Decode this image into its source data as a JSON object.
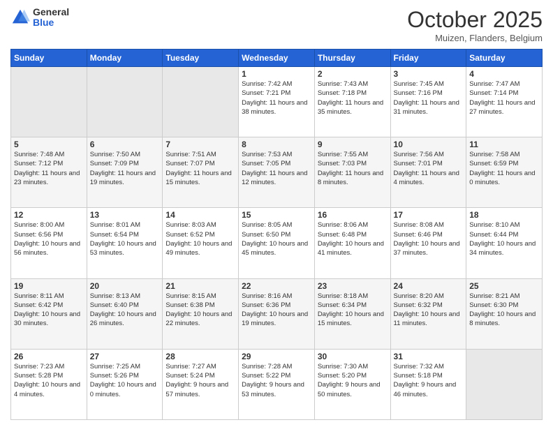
{
  "header": {
    "logo_general": "General",
    "logo_blue": "Blue",
    "month_title": "October 2025",
    "location": "Muizen, Flanders, Belgium"
  },
  "weekdays": [
    "Sunday",
    "Monday",
    "Tuesday",
    "Wednesday",
    "Thursday",
    "Friday",
    "Saturday"
  ],
  "weeks": [
    [
      {
        "day": "",
        "sunrise": "",
        "sunset": "",
        "daylight": "",
        "empty": true
      },
      {
        "day": "",
        "sunrise": "",
        "sunset": "",
        "daylight": "",
        "empty": true
      },
      {
        "day": "",
        "sunrise": "",
        "sunset": "",
        "daylight": "",
        "empty": true
      },
      {
        "day": "1",
        "sunrise": "Sunrise: 7:42 AM",
        "sunset": "Sunset: 7:21 PM",
        "daylight": "Daylight: 11 hours and 38 minutes."
      },
      {
        "day": "2",
        "sunrise": "Sunrise: 7:43 AM",
        "sunset": "Sunset: 7:18 PM",
        "daylight": "Daylight: 11 hours and 35 minutes."
      },
      {
        "day": "3",
        "sunrise": "Sunrise: 7:45 AM",
        "sunset": "Sunset: 7:16 PM",
        "daylight": "Daylight: 11 hours and 31 minutes."
      },
      {
        "day": "4",
        "sunrise": "Sunrise: 7:47 AM",
        "sunset": "Sunset: 7:14 PM",
        "daylight": "Daylight: 11 hours and 27 minutes."
      }
    ],
    [
      {
        "day": "5",
        "sunrise": "Sunrise: 7:48 AM",
        "sunset": "Sunset: 7:12 PM",
        "daylight": "Daylight: 11 hours and 23 minutes."
      },
      {
        "day": "6",
        "sunrise": "Sunrise: 7:50 AM",
        "sunset": "Sunset: 7:09 PM",
        "daylight": "Daylight: 11 hours and 19 minutes."
      },
      {
        "day": "7",
        "sunrise": "Sunrise: 7:51 AM",
        "sunset": "Sunset: 7:07 PM",
        "daylight": "Daylight: 11 hours and 15 minutes."
      },
      {
        "day": "8",
        "sunrise": "Sunrise: 7:53 AM",
        "sunset": "Sunset: 7:05 PM",
        "daylight": "Daylight: 11 hours and 12 minutes."
      },
      {
        "day": "9",
        "sunrise": "Sunrise: 7:55 AM",
        "sunset": "Sunset: 7:03 PM",
        "daylight": "Daylight: 11 hours and 8 minutes."
      },
      {
        "day": "10",
        "sunrise": "Sunrise: 7:56 AM",
        "sunset": "Sunset: 7:01 PM",
        "daylight": "Daylight: 11 hours and 4 minutes."
      },
      {
        "day": "11",
        "sunrise": "Sunrise: 7:58 AM",
        "sunset": "Sunset: 6:59 PM",
        "daylight": "Daylight: 11 hours and 0 minutes."
      }
    ],
    [
      {
        "day": "12",
        "sunrise": "Sunrise: 8:00 AM",
        "sunset": "Sunset: 6:56 PM",
        "daylight": "Daylight: 10 hours and 56 minutes."
      },
      {
        "day": "13",
        "sunrise": "Sunrise: 8:01 AM",
        "sunset": "Sunset: 6:54 PM",
        "daylight": "Daylight: 10 hours and 53 minutes."
      },
      {
        "day": "14",
        "sunrise": "Sunrise: 8:03 AM",
        "sunset": "Sunset: 6:52 PM",
        "daylight": "Daylight: 10 hours and 49 minutes."
      },
      {
        "day": "15",
        "sunrise": "Sunrise: 8:05 AM",
        "sunset": "Sunset: 6:50 PM",
        "daylight": "Daylight: 10 hours and 45 minutes."
      },
      {
        "day": "16",
        "sunrise": "Sunrise: 8:06 AM",
        "sunset": "Sunset: 6:48 PM",
        "daylight": "Daylight: 10 hours and 41 minutes."
      },
      {
        "day": "17",
        "sunrise": "Sunrise: 8:08 AM",
        "sunset": "Sunset: 6:46 PM",
        "daylight": "Daylight: 10 hours and 37 minutes."
      },
      {
        "day": "18",
        "sunrise": "Sunrise: 8:10 AM",
        "sunset": "Sunset: 6:44 PM",
        "daylight": "Daylight: 10 hours and 34 minutes."
      }
    ],
    [
      {
        "day": "19",
        "sunrise": "Sunrise: 8:11 AM",
        "sunset": "Sunset: 6:42 PM",
        "daylight": "Daylight: 10 hours and 30 minutes."
      },
      {
        "day": "20",
        "sunrise": "Sunrise: 8:13 AM",
        "sunset": "Sunset: 6:40 PM",
        "daylight": "Daylight: 10 hours and 26 minutes."
      },
      {
        "day": "21",
        "sunrise": "Sunrise: 8:15 AM",
        "sunset": "Sunset: 6:38 PM",
        "daylight": "Daylight: 10 hours and 22 minutes."
      },
      {
        "day": "22",
        "sunrise": "Sunrise: 8:16 AM",
        "sunset": "Sunset: 6:36 PM",
        "daylight": "Daylight: 10 hours and 19 minutes."
      },
      {
        "day": "23",
        "sunrise": "Sunrise: 8:18 AM",
        "sunset": "Sunset: 6:34 PM",
        "daylight": "Daylight: 10 hours and 15 minutes."
      },
      {
        "day": "24",
        "sunrise": "Sunrise: 8:20 AM",
        "sunset": "Sunset: 6:32 PM",
        "daylight": "Daylight: 10 hours and 11 minutes."
      },
      {
        "day": "25",
        "sunrise": "Sunrise: 8:21 AM",
        "sunset": "Sunset: 6:30 PM",
        "daylight": "Daylight: 10 hours and 8 minutes."
      }
    ],
    [
      {
        "day": "26",
        "sunrise": "Sunrise: 7:23 AM",
        "sunset": "Sunset: 5:28 PM",
        "daylight": "Daylight: 10 hours and 4 minutes."
      },
      {
        "day": "27",
        "sunrise": "Sunrise: 7:25 AM",
        "sunset": "Sunset: 5:26 PM",
        "daylight": "Daylight: 10 hours and 0 minutes."
      },
      {
        "day": "28",
        "sunrise": "Sunrise: 7:27 AM",
        "sunset": "Sunset: 5:24 PM",
        "daylight": "Daylight: 9 hours and 57 minutes."
      },
      {
        "day": "29",
        "sunrise": "Sunrise: 7:28 AM",
        "sunset": "Sunset: 5:22 PM",
        "daylight": "Daylight: 9 hours and 53 minutes."
      },
      {
        "day": "30",
        "sunrise": "Sunrise: 7:30 AM",
        "sunset": "Sunset: 5:20 PM",
        "daylight": "Daylight: 9 hours and 50 minutes."
      },
      {
        "day": "31",
        "sunrise": "Sunrise: 7:32 AM",
        "sunset": "Sunset: 5:18 PM",
        "daylight": "Daylight: 9 hours and 46 minutes."
      },
      {
        "day": "",
        "sunrise": "",
        "sunset": "",
        "daylight": "",
        "empty": true
      }
    ]
  ]
}
